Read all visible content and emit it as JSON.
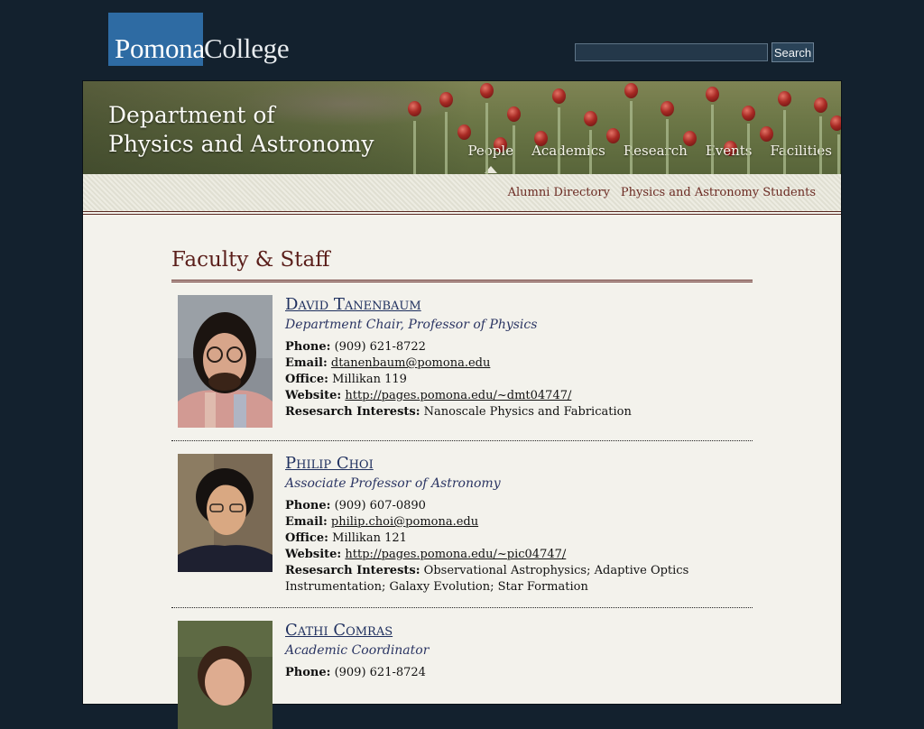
{
  "header": {
    "logo_left": "Pomona",
    "logo_right": "College",
    "search_placeholder": "",
    "search_button": "Search"
  },
  "banner": {
    "dept_line1": "Department of",
    "dept_line2": "Physics and Astronomy"
  },
  "nav": {
    "items": [
      "People",
      "Academics",
      "Research",
      "Events",
      "Facilities"
    ],
    "active": "People"
  },
  "subnav": {
    "items": [
      "Alumni Directory",
      "Physics and Astronomy Students"
    ]
  },
  "page": {
    "title": "Faculty & Staff"
  },
  "labels": {
    "phone": "Phone:",
    "email": "Email:",
    "office": "Office:",
    "website": "Website:",
    "interests": "Resesarch Interests:"
  },
  "people": [
    {
      "name": "David Tanenbaum",
      "title": "Department Chair, Professor of Physics",
      "phone": "(909) 621-8722",
      "email": "dtanenbaum@pomona.edu",
      "office": "Millikan 119",
      "website": "http://pages.pomona.edu/~dmt04747/",
      "interests": "Nanoscale Physics and Fabrication"
    },
    {
      "name": "Philip Choi",
      "title": "Associate Professor of Astronomy",
      "phone": "(909) 607-0890",
      "email": "philip.choi@pomona.edu",
      "office": "Millikan 121",
      "website": "http://pages.pomona.edu/~pic04747/",
      "interests": "Observational Astrophysics; Adaptive Optics Instrumentation; Galaxy Evolution; Star Formation"
    },
    {
      "name": "Cathi Comras",
      "title": "Academic Coordinator",
      "phone": "(909) 621-8724"
    }
  ],
  "colors": {
    "page_bg": "#13212e",
    "logo_blue": "#2e6ba3",
    "heading_maroon": "#5a1e1a",
    "name_blue": "#1e2f5e"
  }
}
